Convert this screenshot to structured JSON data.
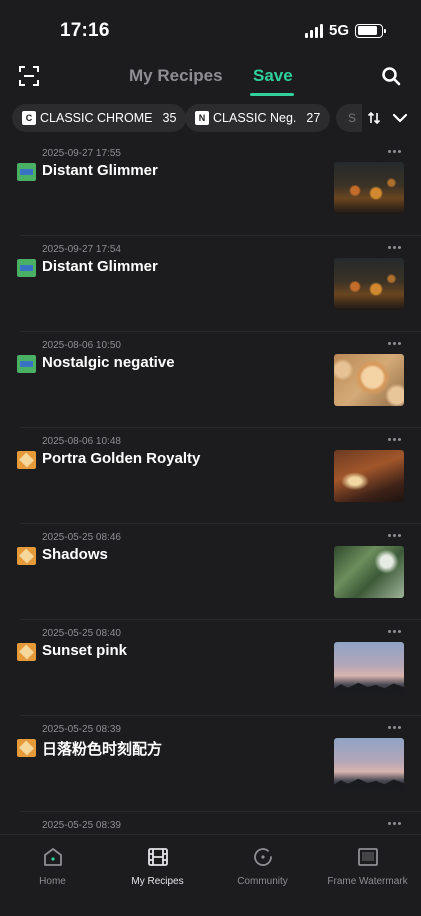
{
  "status": {
    "time": "17:16",
    "network": "5G"
  },
  "tabs": {
    "recipes": "My Recipes",
    "save": "Save",
    "active": "Save"
  },
  "filters": [
    {
      "icon": "C",
      "label": "CLASSIC CHROME",
      "count": "35"
    },
    {
      "icon": "N",
      "label": "CLASSIC Neg.",
      "count": "27"
    }
  ],
  "filters_more": "S",
  "recipes": [
    {
      "date": "2025-09-27 17:55",
      "title": "Distant Glimmer",
      "badge": "classic-chrome",
      "thumb": "night-street"
    },
    {
      "date": "2025-09-27 17:54",
      "title": "Distant Glimmer",
      "badge": "classic-chrome",
      "thumb": "night-street"
    },
    {
      "date": "2025-08-06 10:50",
      "title": "Nostalgic negative",
      "badge": "classic-chrome",
      "thumb": "dahlia-flowers"
    },
    {
      "date": "2025-08-06 10:48",
      "title": "Portra Golden Royalty",
      "badge": "portra",
      "thumb": "church-interior"
    },
    {
      "date": "2025-05-25 08:46",
      "title": "Shadows",
      "badge": "portra",
      "thumb": "leaves"
    },
    {
      "date": "2025-05-25 08:40",
      "title": "Sunset pink",
      "badge": "portra",
      "thumb": "sunset-sky"
    },
    {
      "date": "2025-05-25 08:39",
      "title": "日落粉色时刻配方",
      "badge": "portra",
      "thumb": "sunset-sky"
    },
    {
      "date": "2025-05-25 08:39",
      "title": "",
      "badge": "portra",
      "thumb": "green"
    }
  ],
  "bottom_tabs": [
    {
      "label": "Home",
      "icon": "home-icon"
    },
    {
      "label": "My Recipes",
      "icon": "film-icon"
    },
    {
      "label": "Community",
      "icon": "community-icon"
    },
    {
      "label": "Frame Watermark",
      "icon": "frame-icon"
    }
  ],
  "colors": {
    "accent": "#2fd09a",
    "background": "#1c1c1e",
    "chip": "#2c2c2e"
  }
}
